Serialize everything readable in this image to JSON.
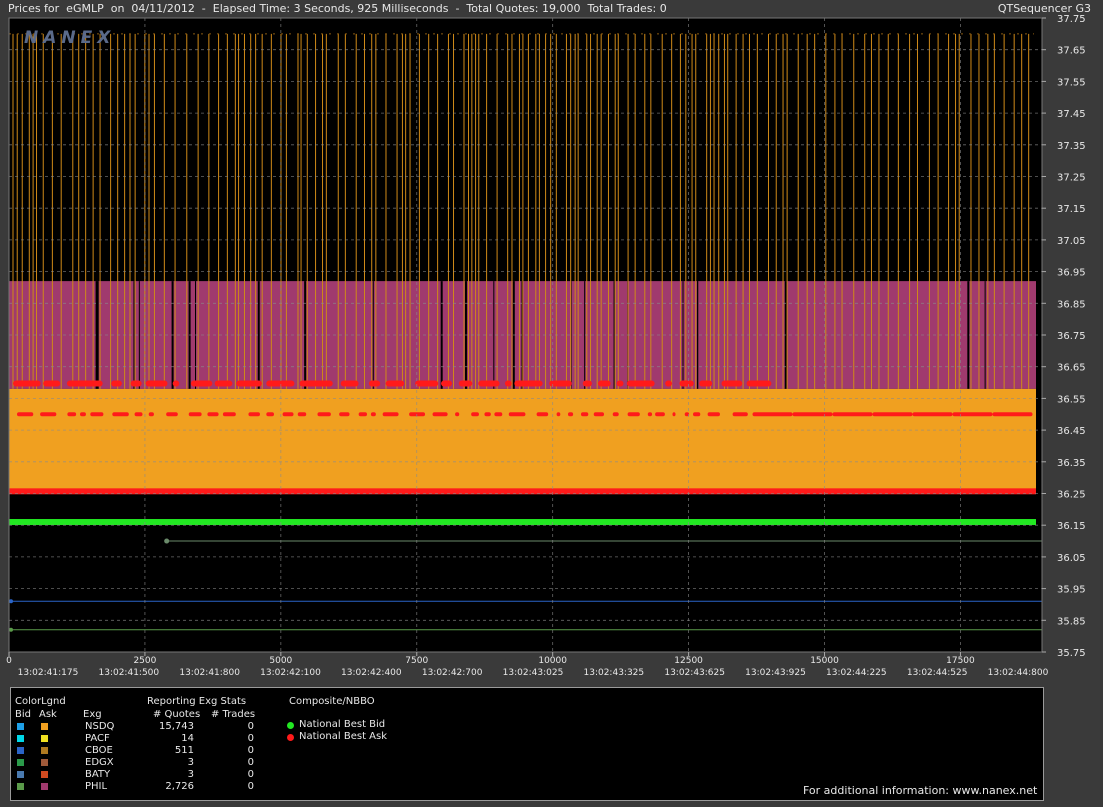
{
  "title_bar": {
    "left_text": "Prices for  eGMLP  on  04/11/2012  -  Elapsed Time: 3 Seconds, 925 Milliseconds  -  Total Quotes: 19,000  Total Trades: 0",
    "right_text": "QTSequencer G3"
  },
  "watermark": "NANEX",
  "chart_data": {
    "type": "line",
    "title": "",
    "y_ticks": [
      "37.75",
      "37.65",
      "37.55",
      "37.45",
      "37.35",
      "37.25",
      "37.15",
      "37.05",
      "36.95",
      "36.85",
      "36.75",
      "36.65",
      "36.55",
      "36.45",
      "36.35",
      "36.25",
      "36.15",
      "36.05",
      "35.95",
      "35.85",
      "35.75"
    ],
    "ylim": [
      35.75,
      37.75
    ],
    "x_ticks": [
      "0",
      "2500",
      "5000",
      "7500",
      "10000",
      "12500",
      "15000",
      "17500"
    ],
    "x_time_labels": [
      "13:02:41:175",
      "13:02:41:500",
      "13:02:41:800",
      "13:02:42:100",
      "13:02:42:400",
      "13:02:42:700",
      "13:02:43:025",
      "13:02:43:325",
      "13:02:43:625",
      "13:02:43:925",
      "13:02:44:225",
      "13:02:44:525",
      "13:02:44:800"
    ],
    "xlim": [
      0,
      19000
    ],
    "grid": true,
    "series": [
      {
        "name": "PHIL",
        "side": "Ask",
        "color": "#a03a6e",
        "low": 36.58,
        "high": 36.92
      },
      {
        "name": "NSDQ",
        "side": "Ask",
        "color": "#f0a020",
        "low": 36.26,
        "high": 36.58
      },
      {
        "name": "NSDQ",
        "side": "Ask",
        "color": "#f0a020",
        "low": 36.58,
        "high": 37.7,
        "style": "spikes"
      },
      {
        "name": "National Best Ask",
        "color": "#ff1a1a",
        "values": [
          36.6,
          36.5,
          36.26
        ]
      },
      {
        "name": "National Best Bid",
        "color": "#22e822",
        "y": 36.16
      },
      {
        "name": "CBOE",
        "side": "Bid",
        "color": "#2a64c8",
        "y": 35.91
      },
      {
        "name": "PHIL",
        "side": "Bid",
        "color": "#5a9a4a",
        "y": 35.82
      },
      {
        "name": "EDGX",
        "side": "Bid",
        "color": "#6a8a6a",
        "y": 36.1,
        "x_start": 2900
      }
    ]
  },
  "legend": {
    "color_legend_label": "ColorLgnd",
    "bid_header": "Bid",
    "ask_header": "Ask",
    "stats_title": "Reporting Exg Stats",
    "exg_header": "Exg",
    "quotes_header": "# Quotes",
    "trades_header": "# Trades",
    "composite_title": "Composite/NBBO",
    "rows": [
      {
        "exg": "NSDQ",
        "quotes": "15,743",
        "trades": "0",
        "bid_color": "#1ea0e8",
        "ask_color": "#f0a020"
      },
      {
        "exg": "PACF",
        "quotes": "14",
        "trades": "0",
        "bid_color": "#00d8e8",
        "ask_color": "#f0e020"
      },
      {
        "exg": "CBOE",
        "quotes": "511",
        "trades": "0",
        "bid_color": "#2a64c8",
        "ask_color": "#b07a20"
      },
      {
        "exg": "EDGX",
        "quotes": "3",
        "trades": "0",
        "bid_color": "#2a9a4a",
        "ask_color": "#a05a3a"
      },
      {
        "exg": "BATY",
        "quotes": "3",
        "trades": "0",
        "bid_color": "#4a7ab0",
        "ask_color": "#d04a20"
      },
      {
        "exg": "PHIL",
        "quotes": "2,726",
        "trades": "0",
        "bid_color": "#5a9a4a",
        "ask_color": "#a03a6e"
      }
    ],
    "nbbo": [
      {
        "label": "National Best Bid",
        "color": "#22e822"
      },
      {
        "label": "National Best Ask",
        "color": "#ff1a1a"
      }
    ],
    "footer": "For additional information: www.nanex.net"
  }
}
